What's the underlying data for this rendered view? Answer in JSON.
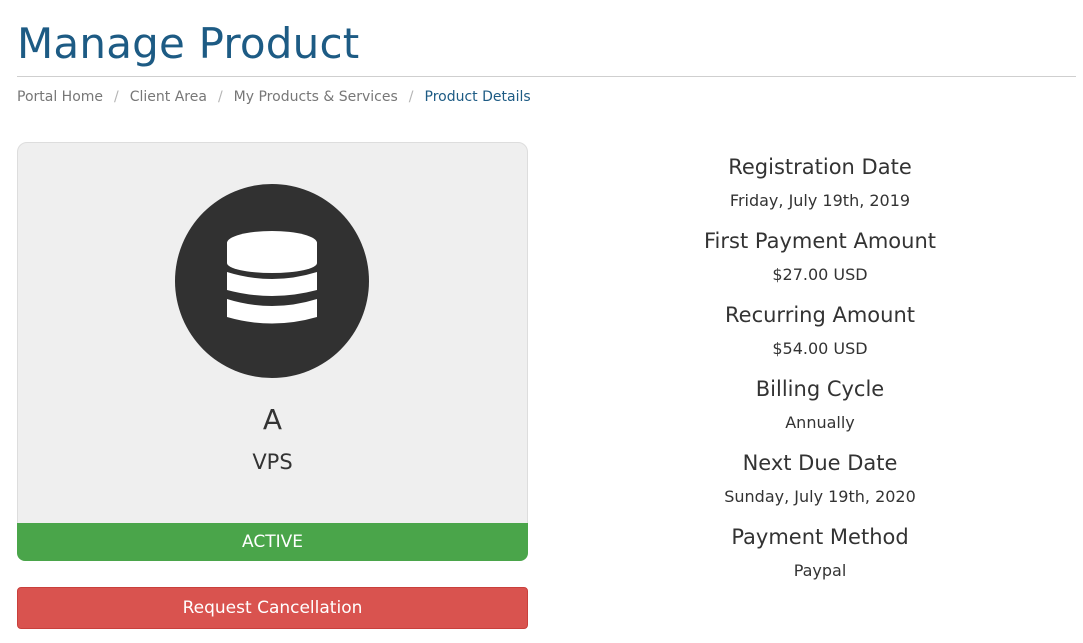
{
  "page": {
    "title": "Manage Product"
  },
  "breadcrumb": {
    "items": [
      {
        "label": "Portal Home"
      },
      {
        "label": "Client Area"
      },
      {
        "label": "My Products & Services"
      },
      {
        "label": "Product Details"
      }
    ],
    "separator": "/"
  },
  "product": {
    "icon": "database-icon",
    "name": "A",
    "group": "VPS",
    "status": "ACTIVE",
    "status_color": "#4aa54a",
    "cancel_label": "Request Cancellation",
    "cancel_color": "#d9534f"
  },
  "details": [
    {
      "label": "Registration Date",
      "value": "Friday, July 19th, 2019"
    },
    {
      "label": "First Payment Amount",
      "value": "$27.00 USD"
    },
    {
      "label": "Recurring Amount",
      "value": "$54.00 USD"
    },
    {
      "label": "Billing Cycle",
      "value": "Annually"
    },
    {
      "label": "Next Due Date",
      "value": "Sunday, July 19th, 2020"
    },
    {
      "label": "Payment Method",
      "value": "Paypal"
    }
  ],
  "colors": {
    "title": "#1d5b84",
    "breadcrumb_active": "#1d5b84"
  }
}
